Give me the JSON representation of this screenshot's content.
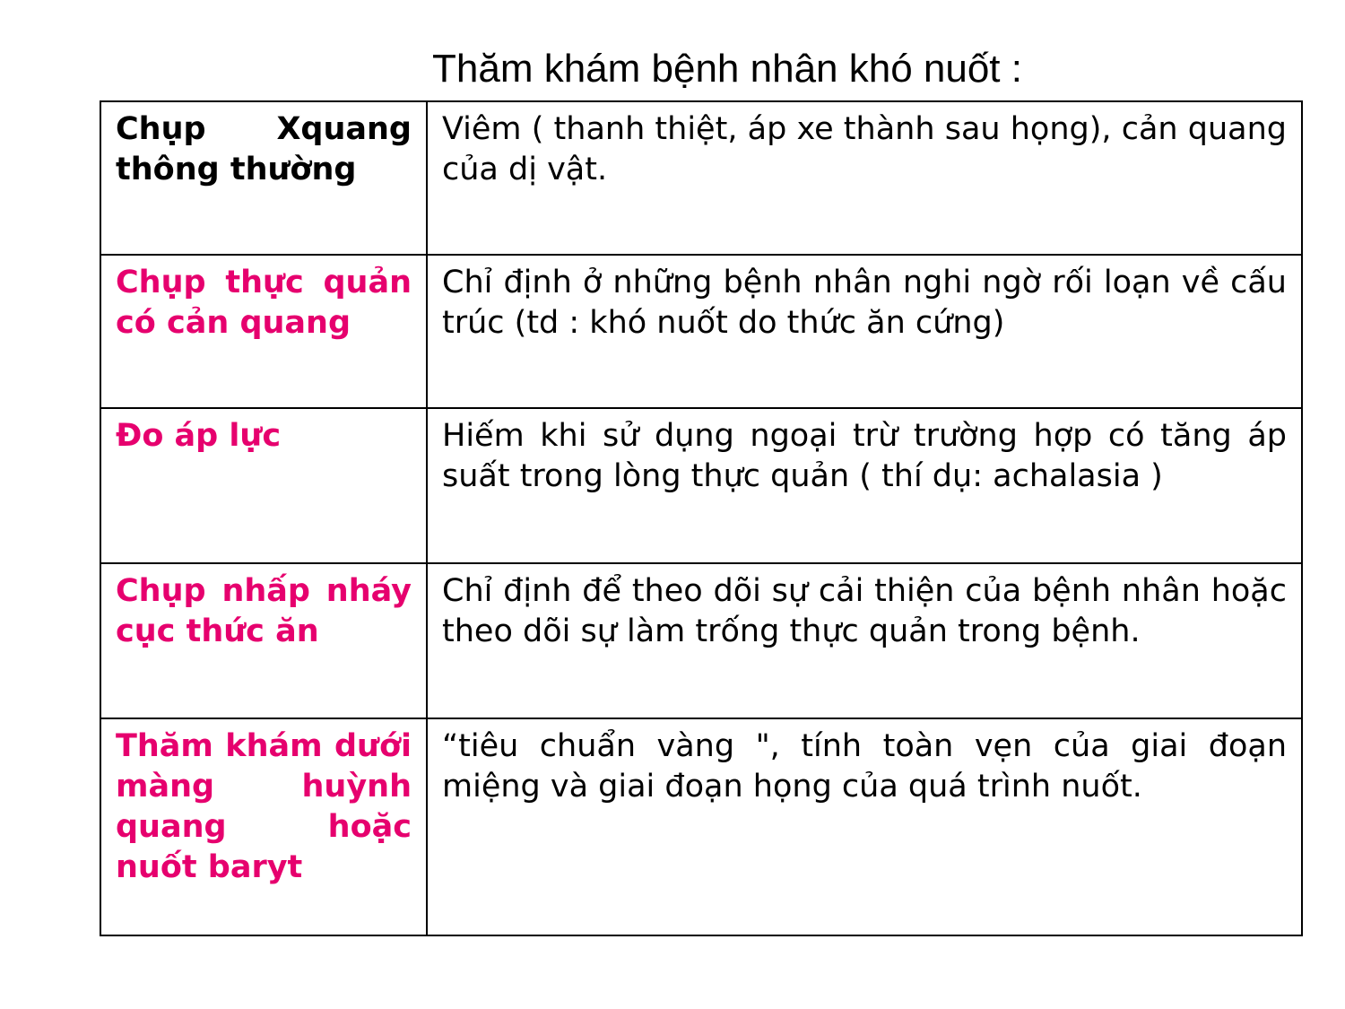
{
  "title": "Thăm khám bệnh nhân khó nuốt :",
  "colors": {
    "accent": "#e6006e",
    "text": "#000000",
    "border": "#000000"
  },
  "rows": [
    {
      "method": "Chụp Xquang thông thường",
      "description": "Viêm ( thanh thiệt, áp xe thành sau họng), cản quang của dị  vật."
    },
    {
      "method": "Chụp thực quản có cản quang",
      "description": "Chỉ định ở những bệnh nhân nghi ngờ rối loạn về cấu trúc (td : khó nuốt do thức ăn cứng)"
    },
    {
      "method": "Đo áp lực",
      "description": "Hiếm khi sử dụng ngoại trừ trường hợp có tăng áp suất trong lòng thực quản ( thí dụ: achalasia )"
    },
    {
      "method": "Chụp nhấp nháy cục thức ăn",
      "description": "Chỉ định để theo dõi sự cải thiện của bệnh nhân hoặc theo dõi sự làm trống thực quản trong bệnh."
    },
    {
      "method": "Thăm khám dưới màng huỳnh quang hoặc nuốt baryt",
      "description": "“tiêu chuẩn vàng \", tính toàn vẹn của giai đoạn miệng và giai đoạn họng của quá trình nuốt."
    }
  ]
}
